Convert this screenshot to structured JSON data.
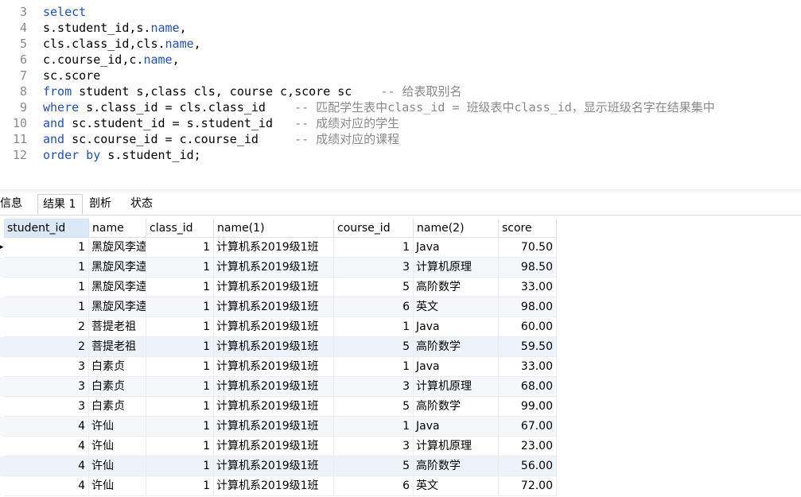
{
  "editor": {
    "lines": [
      {
        "num": "3",
        "segments": [
          {
            "t": "select",
            "c": "kw"
          }
        ]
      },
      {
        "num": "4",
        "segments": [
          {
            "t": "s.student_id,s.",
            "c": ""
          },
          {
            "t": "name",
            "c": "fn"
          },
          {
            "t": ",",
            "c": ""
          }
        ]
      },
      {
        "num": "5",
        "segments": [
          {
            "t": "cls.class_id,cls.",
            "c": ""
          },
          {
            "t": "name",
            "c": "fn"
          },
          {
            "t": ",",
            "c": ""
          }
        ]
      },
      {
        "num": "6",
        "segments": [
          {
            "t": "c.course_id,c.",
            "c": ""
          },
          {
            "t": "name",
            "c": "fn"
          },
          {
            "t": ",",
            "c": ""
          }
        ]
      },
      {
        "num": "7",
        "segments": [
          {
            "t": "sc.score",
            "c": ""
          }
        ]
      },
      {
        "num": "8",
        "segments": [
          {
            "t": "from",
            "c": "kw"
          },
          {
            "t": " student s,class cls, course c,score sc    ",
            "c": ""
          },
          {
            "t": "-- 给表取别名",
            "c": "cmt"
          }
        ]
      },
      {
        "num": "9",
        "segments": [
          {
            "t": "where",
            "c": "kw"
          },
          {
            "t": " s.class_id = cls.class_id    ",
            "c": ""
          },
          {
            "t": "-- 匹配学生表中class_id = 班级表中class_id，显示班级名字在结果集中",
            "c": "cmt"
          }
        ]
      },
      {
        "num": "10",
        "segments": [
          {
            "t": "and",
            "c": "kw"
          },
          {
            "t": " sc.student_id = s.student_id   ",
            "c": ""
          },
          {
            "t": "-- 成绩对应的学生",
            "c": "cmt"
          }
        ]
      },
      {
        "num": "11",
        "segments": [
          {
            "t": "and",
            "c": "kw"
          },
          {
            "t": " sc.course_id = c.course_id     ",
            "c": ""
          },
          {
            "t": "-- 成绩对应的课程",
            "c": "cmt"
          }
        ]
      },
      {
        "num": "12",
        "segments": [
          {
            "t": "order by",
            "c": "kw"
          },
          {
            "t": " s.student_id;",
            "c": ""
          }
        ]
      }
    ]
  },
  "tabs": [
    {
      "label": "信息",
      "active": false
    },
    {
      "label": "结果 1",
      "active": true
    },
    {
      "label": "剖析",
      "active": false
    },
    {
      "label": "状态",
      "active": false
    }
  ],
  "grid": {
    "columns": [
      "student_id",
      "name",
      "class_id",
      "name(1)",
      "course_id",
      "name(2)",
      "score"
    ],
    "rows": [
      [
        "1",
        "黑旋风李逵",
        "1",
        "计算机系2019级1班",
        "1",
        "Java",
        "70.50"
      ],
      [
        "1",
        "黑旋风李逵",
        "1",
        "计算机系2019级1班",
        "3",
        "计算机原理",
        "98.50"
      ],
      [
        "1",
        "黑旋风李逵",
        "1",
        "计算机系2019级1班",
        "5",
        "高阶数学",
        "33.00"
      ],
      [
        "1",
        "黑旋风李逵",
        "1",
        "计算机系2019级1班",
        "6",
        "英文",
        "98.00"
      ],
      [
        "2",
        "菩提老祖",
        "1",
        "计算机系2019级1班",
        "1",
        "Java",
        "60.00"
      ],
      [
        "2",
        "菩提老祖",
        "1",
        "计算机系2019级1班",
        "5",
        "高阶数学",
        "59.50"
      ],
      [
        "3",
        "白素贞",
        "1",
        "计算机系2019级1班",
        "1",
        "Java",
        "33.00"
      ],
      [
        "3",
        "白素贞",
        "1",
        "计算机系2019级1班",
        "3",
        "计算机原理",
        "68.00"
      ],
      [
        "3",
        "白素贞",
        "1",
        "计算机系2019级1班",
        "5",
        "高阶数学",
        "99.00"
      ],
      [
        "4",
        "许仙",
        "1",
        "计算机系2019级1班",
        "1",
        "Java",
        "67.00"
      ],
      [
        "4",
        "许仙",
        "1",
        "计算机系2019级1班",
        "3",
        "计算机原理",
        "23.00"
      ],
      [
        "4",
        "许仙",
        "1",
        "计算机系2019级1班",
        "5",
        "高阶数学",
        "56.00"
      ],
      [
        "4",
        "许仙",
        "1",
        "计算机系2019级1班",
        "6",
        "英文",
        "72.00"
      ]
    ]
  }
}
